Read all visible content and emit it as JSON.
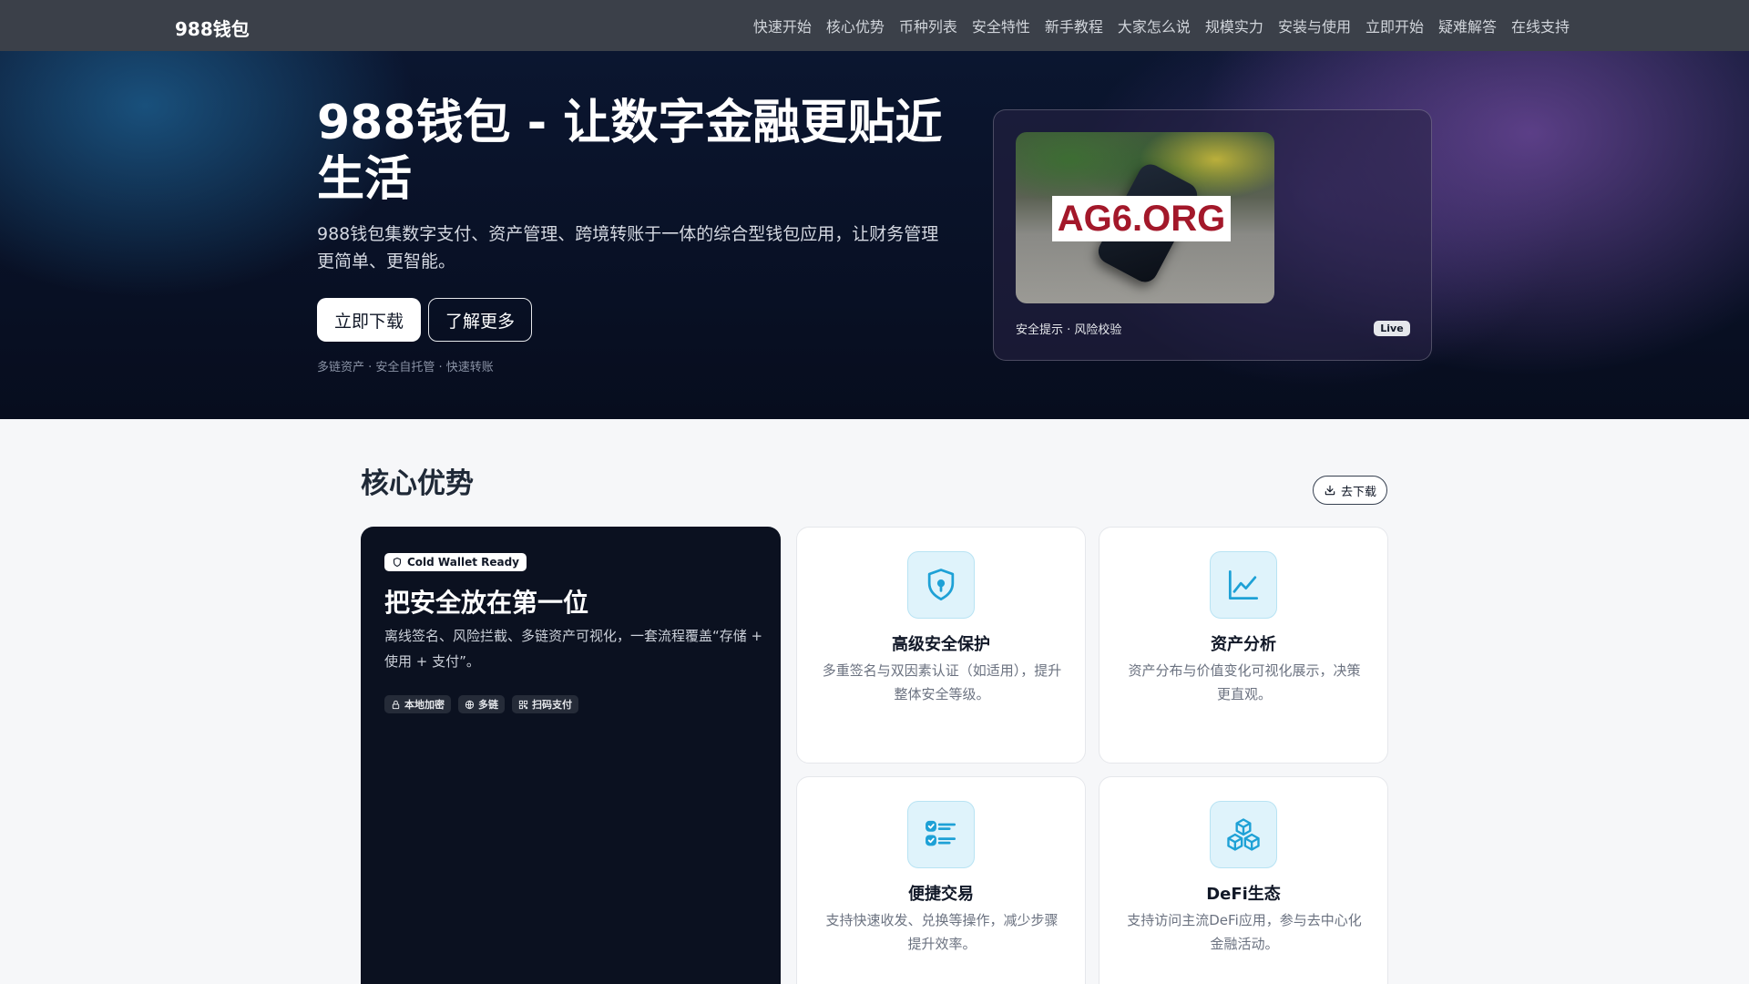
{
  "nav": {
    "brand": "988钱包",
    "links": [
      "快速开始",
      "核心优势",
      "币种列表",
      "安全特性",
      "新手教程",
      "大家怎么说",
      "规模实力",
      "安装与使用",
      "立即开始",
      "疑难解答",
      "在线支持"
    ]
  },
  "hero": {
    "title": "988钱包 - 让数字金融更贴近生活",
    "description": "988钱包集数字支付、资产管理、跨境转账于一体的综合型钱包应用，让财务管理更简单、更智能。",
    "primary_button": "立即下载",
    "secondary_button": "了解更多",
    "tags": "多链资产 · 安全自托管 · 快速转账",
    "preview": {
      "watermark": "AG6.ORG",
      "caption": "安全提示 · 风险校验",
      "badge": "Live"
    }
  },
  "features": {
    "title": "核心优势",
    "download_label": "去下载",
    "highlight": {
      "badge": "Cold Wallet Ready",
      "title": "把安全放在第一位",
      "description": "离线签名、风险拦截、多链资产可视化，一套流程覆盖“存储 + 使用 + 支付”。",
      "chips": [
        "本地加密",
        "多链",
        "扫码支付"
      ]
    },
    "cards": [
      {
        "title": "高级安全保护",
        "description": "多重签名与双因素认证（如适用），提升整体安全等级。",
        "icon": "shield-icon"
      },
      {
        "title": "资产分析",
        "description": "资产分布与价值变化可视化展示，决策更直观。",
        "icon": "chart-line-icon"
      },
      {
        "title": "便捷交易",
        "description": "支持快速收发、兑换等操作，减少步骤提升效率。",
        "icon": "checklist-icon"
      },
      {
        "title": "DeFi生态",
        "description": "支持访问主流DeFi应用，参与去中心化金融活动。",
        "icon": "cubes-icon"
      }
    ]
  },
  "colors": {
    "nav_bg": "#3b4049",
    "hero_bg": "#0b1630",
    "accent": "#1ea1d6",
    "icon_tile": "#dff3fb",
    "dark_card": "#0b1120"
  }
}
